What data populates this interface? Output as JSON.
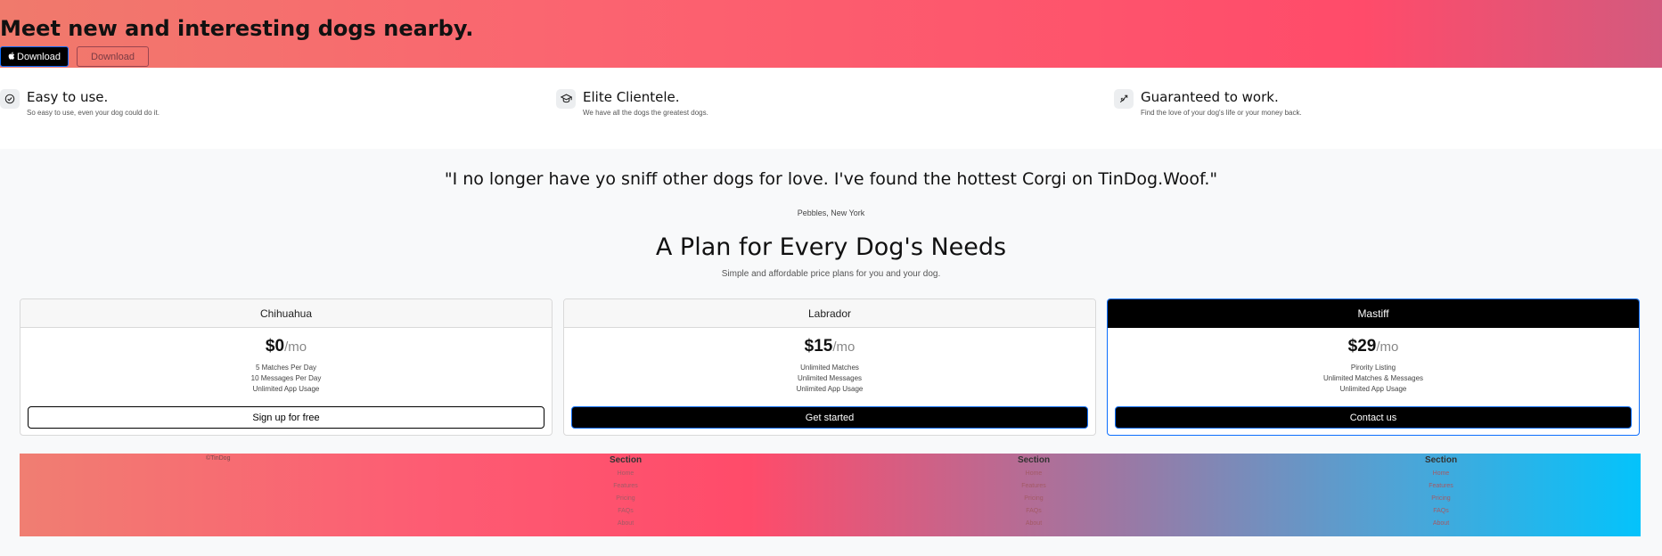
{
  "hero": {
    "title": "Meet new and interesting dogs nearby.",
    "download_primary": "Download",
    "download_secondary": "Download",
    "apple_icon": "apple-icon"
  },
  "features": [
    {
      "icon": "check-circle-icon",
      "title": "Easy to use.",
      "text": "So easy to use, even your dog could do it."
    },
    {
      "icon": "graduation-cap-icon",
      "title": "Elite Clientele.",
      "text": "We have all the dogs the greatest dogs."
    },
    {
      "icon": "heart-arrow-icon",
      "title": "Guaranteed to work.",
      "text": "Find the love of your dog's life or your money back."
    }
  ],
  "testimonial": {
    "quote": "\"I no longer have yo sniff other dogs for love. I've found the hottest Corgi on TinDog.Woof.\"",
    "author": "Pebbles, New York"
  },
  "pricing": {
    "title": "A Plan for Every Dog's Needs",
    "subtitle": "Simple and affordable price plans for you and your dog.",
    "plans": [
      {
        "name": "Chihuahua",
        "price": "$0",
        "per": "/mo",
        "features": [
          "5 Matches Per Day",
          "10 Messages Per Day",
          "Unlimited App Usage"
        ],
        "button": "Sign up for free"
      },
      {
        "name": "Labrador",
        "price": "$15",
        "per": "/mo",
        "features": [
          "Unlimited Matches",
          "Unlimited Messages",
          "Unlimited App Usage"
        ],
        "button": "Get started"
      },
      {
        "name": "Mastiff",
        "price": "$29",
        "per": "/mo",
        "features": [
          "Pirority Listing",
          "Unlimited Matches & Messages",
          "Unlimited App Usage"
        ],
        "button": "Contact us"
      }
    ]
  },
  "footer": {
    "copyright": "©TinDog",
    "columns": [
      {
        "title": "Section",
        "links": [
          "Home",
          "Features",
          "Pricing",
          "FAQs",
          "About"
        ]
      },
      {
        "title": "Section",
        "links": [
          "Home",
          "Features",
          "Pricing",
          "FAQs",
          "About"
        ]
      },
      {
        "title": "Section",
        "links": [
          "Home",
          "Features",
          "Pricing",
          "FAQs",
          "About"
        ]
      }
    ]
  },
  "colors": {
    "accent_blue": "#0d6efd",
    "hero_pink": "#ff4b6a",
    "footer_cyan": "#04c3fb"
  }
}
